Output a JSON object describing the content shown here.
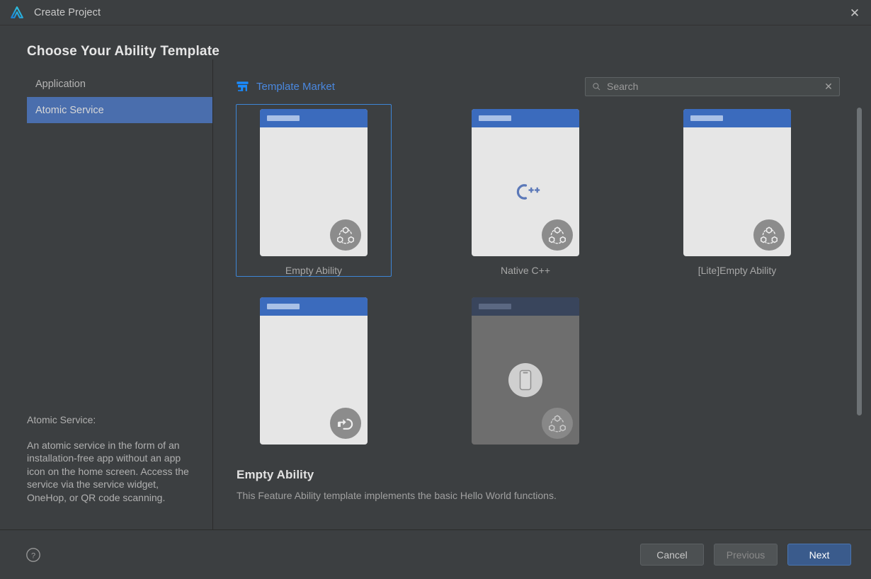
{
  "titlebar": {
    "title": "Create Project",
    "app_icon": "harmonyos-delta-icon",
    "close_label": "✕"
  },
  "page": {
    "title": "Choose Your Ability Template"
  },
  "sidebar": {
    "items": [
      {
        "label": "Application",
        "selected": false
      },
      {
        "label": "Atomic Service",
        "selected": true
      }
    ],
    "description_title": "Atomic Service:",
    "description_text": "An atomic service in the form of an installation-free app without an app icon on the home screen. Access the service via the service widget, OneHop, or QR code scanning."
  },
  "toolbar": {
    "market_label": "Template Market",
    "market_icon": "store-icon",
    "search": {
      "placeholder": "Search",
      "value": "",
      "icon": "search-icon",
      "clear_label": "✕"
    }
  },
  "templates": [
    {
      "label": "Empty Ability",
      "selected": true,
      "center_icon": "none",
      "badge": "atomic-service-badge",
      "dim": false
    },
    {
      "label": "Native C++",
      "selected": false,
      "center_icon": "cpp-logo",
      "badge": "atomic-service-badge",
      "dim": false
    },
    {
      "label": "[Lite]Empty Ability",
      "selected": false,
      "center_icon": "none",
      "badge": "atomic-service-badge",
      "dim": false
    },
    {
      "label": "",
      "selected": false,
      "center_icon": "none",
      "badge": "onehop-badge",
      "dim": false
    },
    {
      "label": "",
      "selected": false,
      "center_icon": "phone-icon",
      "badge": "atomic-service-badge",
      "dim": true
    }
  ],
  "detail": {
    "title": "Empty Ability",
    "description": "This Feature Ability template implements the basic Hello World functions."
  },
  "footer": {
    "help_icon": "help-circle-icon",
    "cancel_label": "Cancel",
    "previous_label": "Previous",
    "next_label": "Next"
  },
  "colors": {
    "window_bg": "#3c3f41",
    "accent_blue": "#4a88df",
    "selection_blue": "#4a6ead",
    "card_selected_border": "#3e86d6",
    "primary_button": "#3a5b8c",
    "thumb_header": "#3b6bbd"
  }
}
